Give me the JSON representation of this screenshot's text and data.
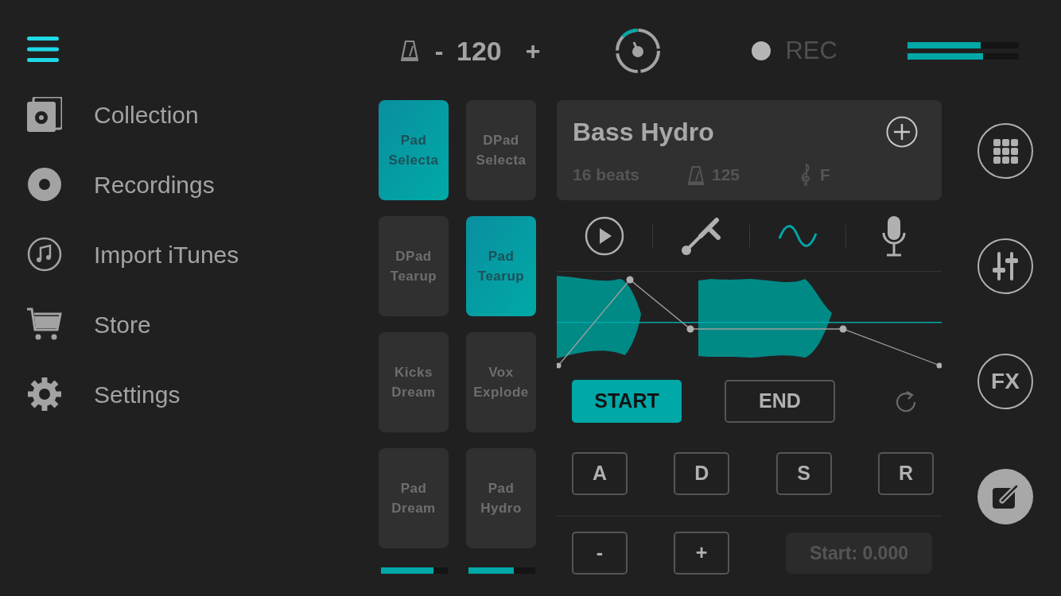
{
  "menu": [
    {
      "label": "Collection",
      "kind": "speaker"
    },
    {
      "label": "Recordings",
      "kind": "disc"
    },
    {
      "label": "Import iTunes",
      "kind": "note"
    },
    {
      "label": "Store",
      "kind": "cart"
    },
    {
      "label": "Settings",
      "kind": "gear"
    }
  ],
  "tempo": {
    "minus": "-",
    "value": "120",
    "plus": "+"
  },
  "record": {
    "label": "REC",
    "on": false
  },
  "meters": [
    {
      "level": 0.66
    },
    {
      "level": 0.68
    }
  ],
  "pads": [
    {
      "line1": "Pad",
      "line2": "Selecta",
      "selected": true
    },
    {
      "line1": "DPad",
      "line2": "Selecta",
      "selected": false
    },
    {
      "line1": "DPad",
      "line2": "Tearup",
      "selected": false
    },
    {
      "line1": "Pad",
      "line2": "Tearup",
      "selected": true
    },
    {
      "line1": "Kicks",
      "line2": "Dream",
      "selected": false
    },
    {
      "line1": "Vox",
      "line2": "Explode",
      "selected": false
    },
    {
      "line1": "Pad",
      "line2": "Dream",
      "selected": false
    },
    {
      "line1": "Pad",
      "line2": "Hydro",
      "selected": false
    }
  ],
  "pad_meters": [
    {
      "level": 0.78
    },
    {
      "level": 0.68
    }
  ],
  "sample": {
    "title": "Bass Hydro",
    "beats": "16 beats",
    "tempo": "125",
    "key": "F"
  },
  "tools": [
    {
      "kind": "play",
      "selected": false
    },
    {
      "kind": "tuner",
      "selected": false
    },
    {
      "kind": "wave",
      "selected": true
    },
    {
      "kind": "mic",
      "selected": false
    }
  ],
  "markers": [
    {
      "label": "START",
      "selected": true
    },
    {
      "label": "END",
      "selected": false
    }
  ],
  "envelope": [
    "A",
    "D",
    "S",
    "R"
  ],
  "nudge": [
    "-",
    "+"
  ],
  "position": {
    "value": "Start: 0.000"
  },
  "side_buttons": [
    {
      "kind": "grid",
      "selected": false
    },
    {
      "kind": "mixer",
      "selected": false
    },
    {
      "kind": "fx",
      "label": "FX",
      "selected": false
    },
    {
      "kind": "edit",
      "selected": true
    }
  ]
}
